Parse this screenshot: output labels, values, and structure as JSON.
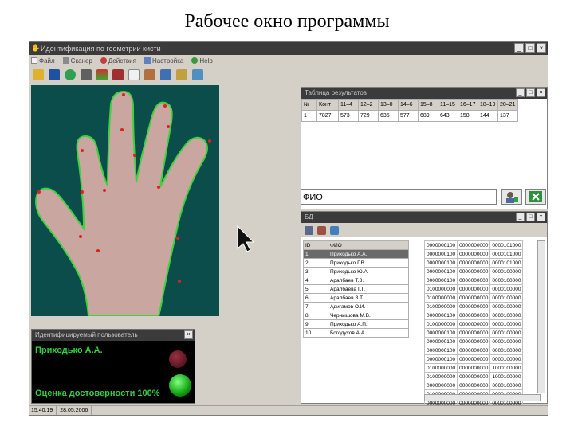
{
  "slide_title": "Рабочее окно программы",
  "app": {
    "title": "Идентификация по геометрии кисти",
    "menu": [
      "Файл",
      "Сканер",
      "Действия",
      "Настройка",
      "Help"
    ],
    "window_controls": [
      "_",
      "□",
      "×"
    ]
  },
  "identified_panel": {
    "title": "Идентифицируемый пользователь",
    "name": "Приходько А.А.",
    "confidence": "Оценка достоверности 100%",
    "close": "×"
  },
  "results_panel": {
    "title": "Таблица результатов",
    "headers": [
      "№",
      "Конт",
      "11–4",
      "12–2",
      "13–0",
      "14–6",
      "15–8",
      "11–15",
      "16–17",
      "18–19",
      "20–21"
    ],
    "rows": [
      [
        "1",
        "7827",
        "573",
        "729",
        "635",
        "577",
        "689",
        "643",
        "158",
        "144",
        "137"
      ]
    ]
  },
  "fio": {
    "value": "ФИО"
  },
  "db_panel": {
    "title": "БД",
    "headers": [
      "ID",
      "ФИО"
    ],
    "rows": [
      [
        "1",
        "Приходько А.А."
      ],
      [
        "2",
        "Приходько Г.В."
      ],
      [
        "3",
        "Приходько Ю.А."
      ],
      [
        "4",
        "Аралбаев Т.З."
      ],
      [
        "5",
        "Аралбаева Г.Г."
      ],
      [
        "6",
        "Аралбаев З.Т."
      ],
      [
        "7",
        "Адигамов О.И."
      ],
      [
        "8",
        "Чернышова М.В."
      ],
      [
        "9",
        "Приходько А.П."
      ],
      [
        "10",
        "Богодухов А.А."
      ]
    ],
    "codes": [
      [
        "0000000100",
        "0000000000",
        "0000101000"
      ],
      [
        "0000000100",
        "0000000000",
        "0000101000"
      ],
      [
        "0000000100",
        "0000000000",
        "0000101000"
      ],
      [
        "0000000100",
        "0000000000",
        "0000100000"
      ],
      [
        "0000000100",
        "0000000000",
        "0000100000"
      ],
      [
        "0100000000",
        "0000000000",
        "0000100000"
      ],
      [
        "0100000000",
        "0000000000",
        "0000100000"
      ],
      [
        "0100000000",
        "0000000000",
        "0000100000"
      ],
      [
        "0000000100",
        "0000000000",
        "0000100000"
      ],
      [
        "0100000000",
        "0000000000",
        "0000100000"
      ],
      [
        "0000000100",
        "0000000000",
        "0000100000"
      ],
      [
        "0000000100",
        "0000000000",
        "0000100000"
      ],
      [
        "0000000100",
        "0000000000",
        "0000100000"
      ],
      [
        "0000000100",
        "0000000000",
        "0000100000"
      ],
      [
        "0100000000",
        "0000000000",
        "1000100000"
      ],
      [
        "0100000000",
        "0000000000",
        "1000100000"
      ],
      [
        "0000000000",
        "0000000000",
        "0000100000"
      ],
      [
        "0100000000",
        "0000000000",
        "0000100000"
      ],
      [
        "0000000000",
        "0000000000",
        "0000100000"
      ]
    ]
  },
  "status": {
    "time": "15:40:19",
    "date": "28.05.2006"
  }
}
